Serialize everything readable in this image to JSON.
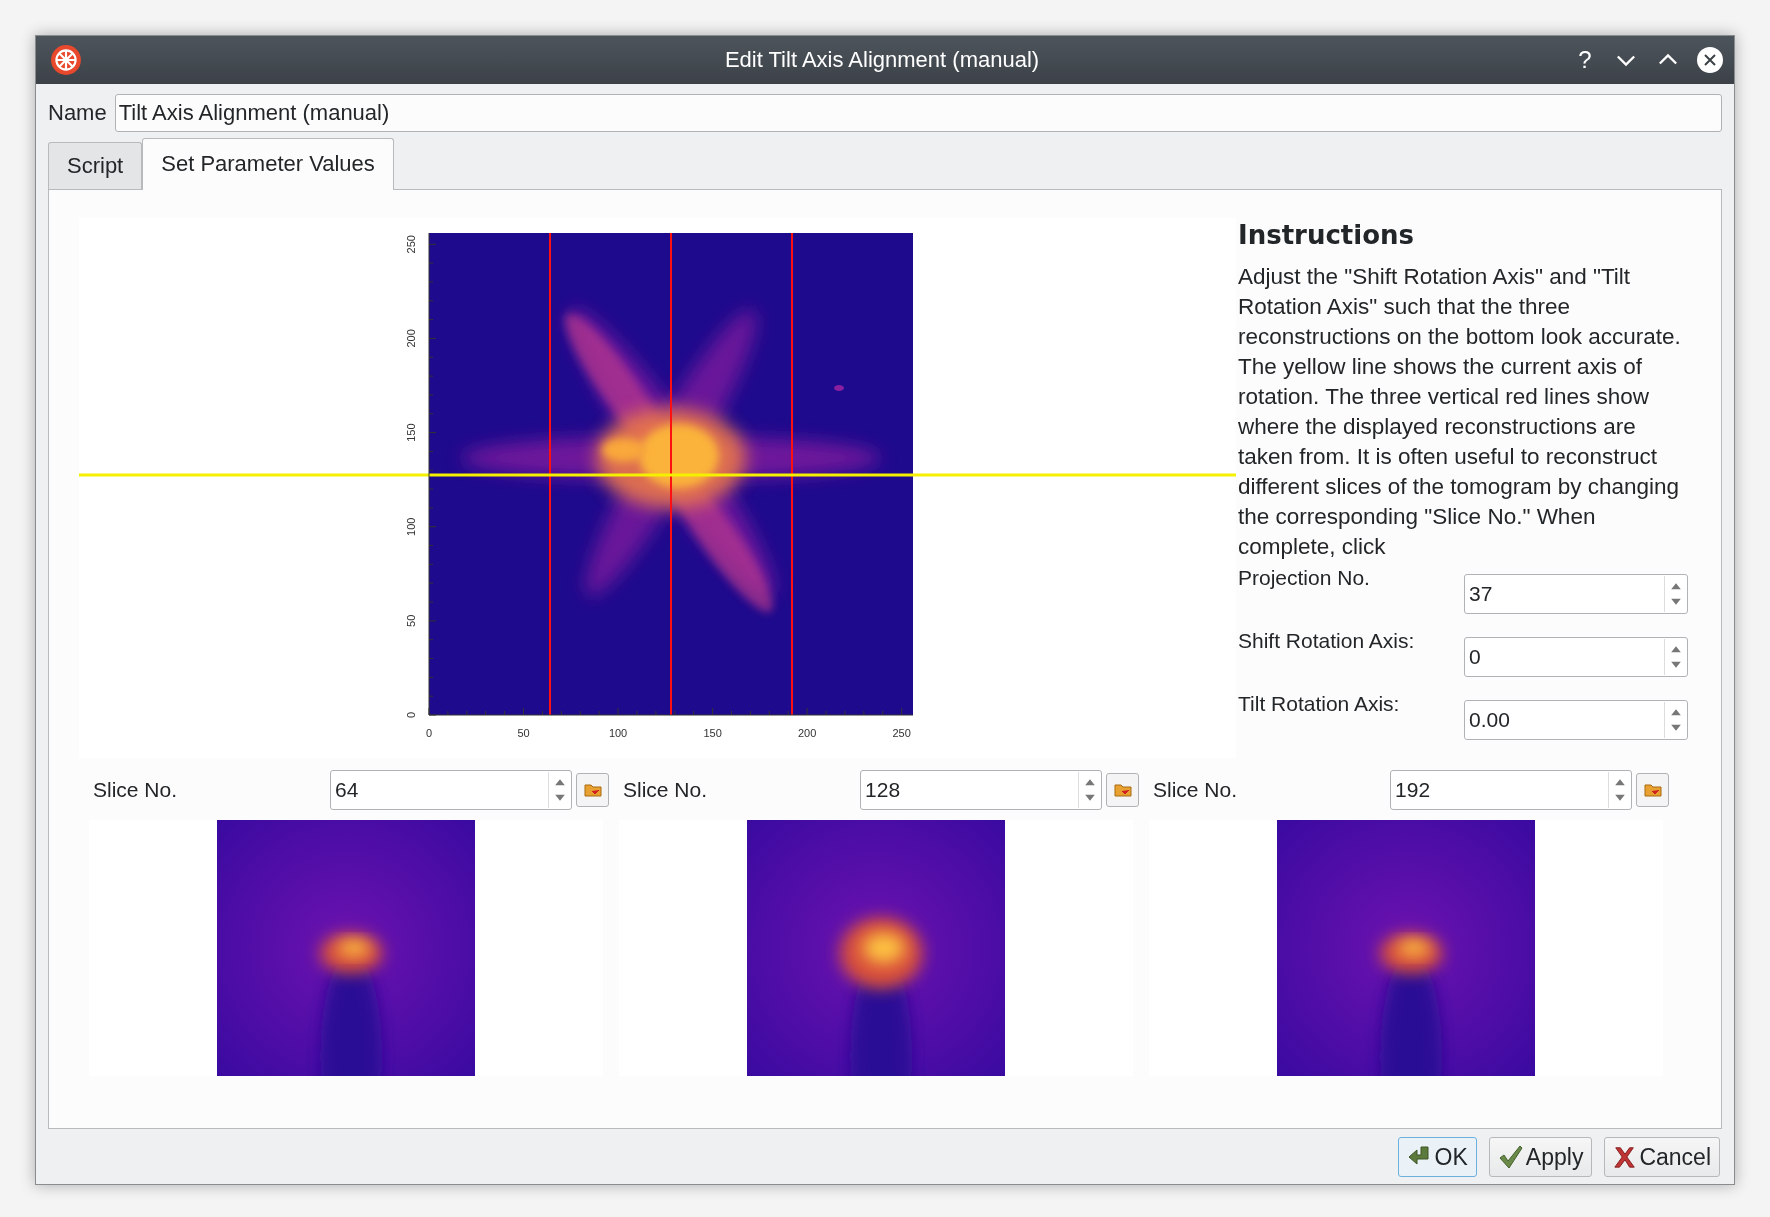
{
  "window": {
    "title": "Edit Tilt Axis Alignment (manual)",
    "help_glyph": "?"
  },
  "name_field": {
    "label": "Name",
    "value": "Tilt Axis Alignment (manual)"
  },
  "tabs": [
    {
      "label": "Script",
      "selected": false
    },
    {
      "label": "Set Parameter Values",
      "selected": true
    }
  ],
  "plot": {
    "xticks": [
      "0",
      "50",
      "100",
      "150",
      "200",
      "250"
    ],
    "yticks": [
      "0",
      "50",
      "100",
      "150",
      "200",
      "250"
    ]
  },
  "instructions": {
    "heading": "Instructions",
    "text": "Adjust the \"Shift Rotation Axis\" and \"Tilt Rotation Axis\" such that the three reconstructions on the bottom look accurate. The yellow line shows the current axis of rotation. The three vertical red lines show where the displayed reconstructions are taken from. It is often useful to reconstruct different slices of the tomogram by changing the corresponding \"Slice No.\" When complete, click"
  },
  "parameters": [
    {
      "label": "Projection No.",
      "value": "37"
    },
    {
      "label": "Shift Rotation Axis:",
      "value": "0"
    },
    {
      "label": "Tilt Rotation Axis:",
      "value": "0.00"
    }
  ],
  "slices": [
    {
      "label": "Slice No.",
      "value": "64"
    },
    {
      "label": "Slice No.",
      "value": "128"
    },
    {
      "label": "Slice No.",
      "value": "192"
    }
  ],
  "buttons": [
    {
      "kind": "ok",
      "label": "OK",
      "focused": true
    },
    {
      "kind": "apply",
      "label": "Apply",
      "focused": false
    },
    {
      "kind": "cancel",
      "label": "Cancel",
      "focused": false
    }
  ]
}
